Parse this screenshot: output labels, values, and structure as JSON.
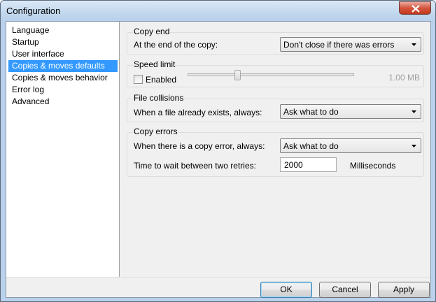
{
  "window": {
    "title": "Configuration"
  },
  "sidebar": {
    "items": [
      {
        "label": "Language"
      },
      {
        "label": "Startup"
      },
      {
        "label": "User interface"
      },
      {
        "label": "Copies & moves defaults"
      },
      {
        "label": "Copies & moves behavior"
      },
      {
        "label": "Error log"
      },
      {
        "label": "Advanced"
      }
    ],
    "selected_index": 3
  },
  "copy_end": {
    "title": "Copy end",
    "label": "At the end of the copy:",
    "value": "Don't close if there was errors"
  },
  "speed_limit": {
    "title": "Speed limit",
    "enabled_label": "Enabled",
    "enabled": false,
    "value_text": "1.00 MB",
    "slider_fraction": 0.3
  },
  "file_collisions": {
    "title": "File collisions",
    "label": "When a file already exists, always:",
    "value": "Ask what to do"
  },
  "copy_errors": {
    "title": "Copy errors",
    "label": "When there is a copy error, always:",
    "value": "Ask what to do",
    "retry_label": "Time to wait between two retries:",
    "retry_value": "2000",
    "retry_unit": "Milliseconds"
  },
  "buttons": {
    "ok": "OK",
    "cancel": "Cancel",
    "apply": "Apply"
  },
  "colors": {
    "selection": "#3399ff",
    "close_button": "#c2361d"
  }
}
